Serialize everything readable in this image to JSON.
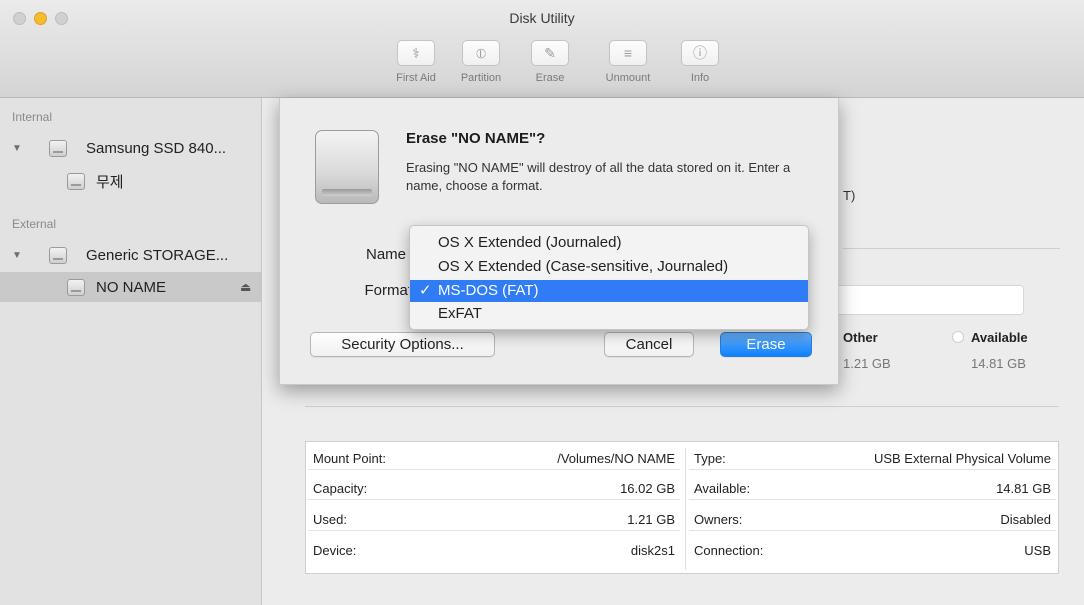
{
  "window": {
    "title": "Disk Utility"
  },
  "toolbar": {
    "items": [
      {
        "label": "First Aid",
        "icon": "stethoscope-icon"
      },
      {
        "label": "Partition",
        "icon": "partition-icon"
      },
      {
        "label": "Erase",
        "icon": "erase-icon"
      },
      {
        "label": "Unmount",
        "icon": "unmount-icon"
      },
      {
        "label": "Info",
        "icon": "info-icon"
      }
    ]
  },
  "sidebar": {
    "internal_header": "Internal",
    "external_header": "External",
    "items": [
      {
        "label": "Samsung SSD 840...",
        "section": "internal",
        "level": 0
      },
      {
        "label": "무제",
        "section": "internal",
        "level": 1
      },
      {
        "label": "Generic STORAGE...",
        "section": "external",
        "level": 0
      },
      {
        "label": "NO NAME",
        "section": "external",
        "level": 1,
        "selected": true
      }
    ]
  },
  "dialog": {
    "title": "Erase \"NO NAME\"?",
    "message": "Erasing \"NO NAME\" will destroy of all the data stored on it. Enter a name, choose a format.",
    "name_label": "Name",
    "format_label": "Format",
    "security_button": "Security Options...",
    "cancel_button": "Cancel",
    "erase_button": "Erase"
  },
  "format_menu": {
    "options": [
      "OS X Extended (Journaled)",
      "OS X Extended (Case-sensitive, Journaled)",
      "MS-DOS (FAT)",
      "ExFAT"
    ],
    "selected": "MS-DOS (FAT)",
    "check": "✓"
  },
  "volume": {
    "partial_text": "T)",
    "legend": [
      {
        "title": "Other",
        "value": "1.21 GB"
      },
      {
        "title": "Available",
        "value": "14.81 GB"
      }
    ]
  },
  "info_table": {
    "left": [
      {
        "key": "Mount Point:",
        "value": "/Volumes/NO NAME"
      },
      {
        "key": "Capacity:",
        "value": "16.02 GB"
      },
      {
        "key": "Used:",
        "value": "1.21 GB"
      },
      {
        "key": "Device:",
        "value": "disk2s1"
      }
    ],
    "right": [
      {
        "key": "Type:",
        "value": "USB External Physical Volume"
      },
      {
        "key": "Available:",
        "value": "14.81 GB"
      },
      {
        "key": "Owners:",
        "value": "Disabled"
      },
      {
        "key": "Connection:",
        "value": "USB"
      }
    ]
  }
}
